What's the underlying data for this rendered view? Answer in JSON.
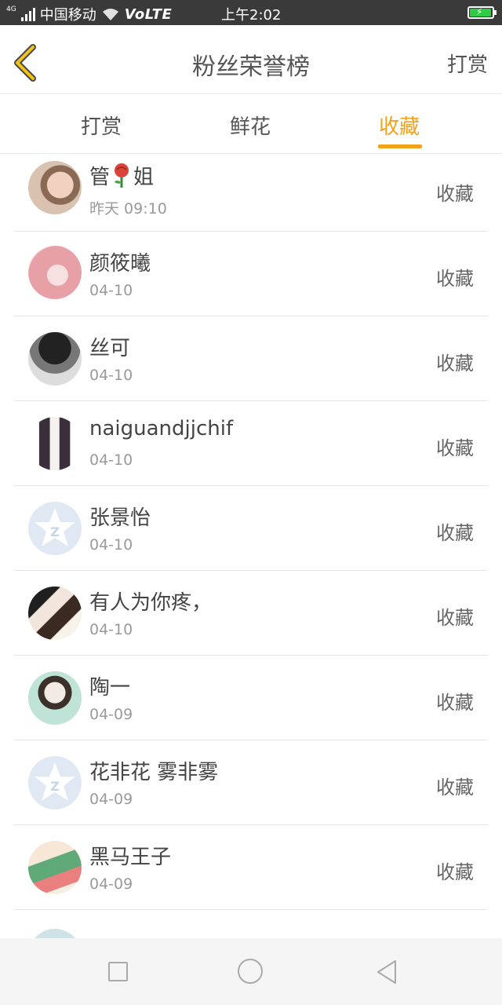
{
  "status_bar": {
    "network": "4G",
    "carrier": "中国移动",
    "volte": "VoLTE",
    "time": "上午2:02",
    "icons": [
      "signal-icon",
      "wifi-icon",
      "battery-charging-icon"
    ]
  },
  "header": {
    "title": "粉丝荣誉榜",
    "action_label": "打赏",
    "back_icon": "chevron-left-icon"
  },
  "tabs": [
    {
      "label": "打赏",
      "active": false
    },
    {
      "label": "鲜花",
      "active": false
    },
    {
      "label": "收藏",
      "active": true
    }
  ],
  "accent_color": "#f2a21b",
  "list": {
    "items": [
      {
        "name_parts": [
          "管",
          "姐"
        ],
        "name_icon": "rose-icon",
        "date": "昨天 09:10",
        "action": "收藏",
        "avatar": "photo-avatar"
      },
      {
        "name": "颜筱曦",
        "date": "04-10",
        "action": "收藏",
        "avatar": "pink-hair-avatar"
      },
      {
        "name": "丝可",
        "date": "04-10",
        "action": "收藏",
        "avatar": "black-cap-avatar"
      },
      {
        "name": "naiguandjjchif",
        "date": "04-10",
        "action": "收藏",
        "avatar": "cartoon-couple-avatar"
      },
      {
        "name": "张景怡",
        "date": "04-10",
        "action": "收藏",
        "avatar": "default-star-avatar"
      },
      {
        "name": "有人为你疼，",
        "date": "04-10",
        "action": "收藏",
        "avatar": "two-girls-avatar"
      },
      {
        "name": "陶一",
        "date": "04-09",
        "action": "收藏",
        "avatar": "girl-avatar"
      },
      {
        "name": "花非花 雾非雾",
        "date": "04-09",
        "action": "收藏",
        "avatar": "default-star-avatar"
      },
      {
        "name": "黑马王子",
        "date": "04-09",
        "action": "收藏",
        "avatar": "cartoon-avatar"
      }
    ]
  },
  "nav_bar": {
    "icons": [
      "recent-apps-icon",
      "home-icon",
      "back-triangle-icon"
    ]
  }
}
